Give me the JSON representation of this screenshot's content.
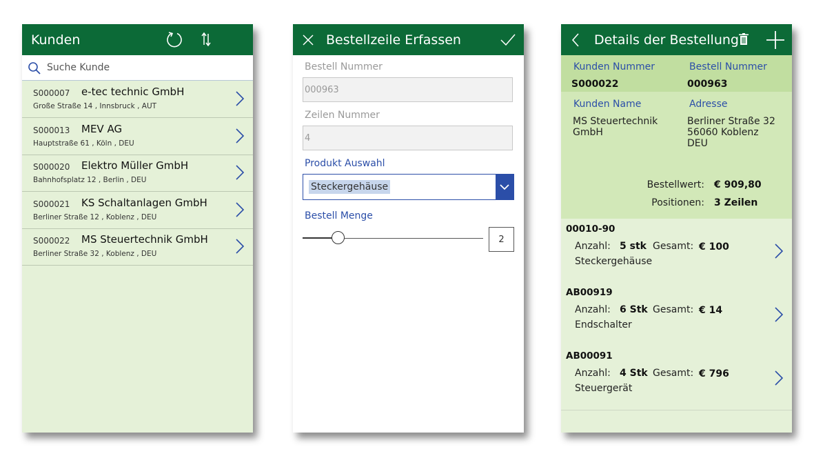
{
  "customers_screen": {
    "title": "Kunden",
    "refresh_icon": "refresh-icon",
    "sort_icon": "sort-icon",
    "search_placeholder": "Suche Kunde",
    "customers": [
      {
        "id": "S000007",
        "name": "e-tec technic GmbH",
        "address": "Große Straße 14 , Innsbruck , AUT"
      },
      {
        "id": "S000013",
        "name": "MEV AG",
        "address": "Hauptstraße 61 , Köln , DEU"
      },
      {
        "id": "S000020",
        "name": "Elektro Müller GmbH",
        "address": "Bahnhofsplatz 12 , Berlin , DEU"
      },
      {
        "id": "S000021",
        "name": "KS Schaltanlagen GmbH",
        "address": "Berliner Straße 12 , Koblenz , DEU"
      },
      {
        "id": "S000022",
        "name": "MS Steuertechnik GmbH",
        "address": "Berliner Straße 32 , Koblenz , DEU"
      }
    ]
  },
  "order_line_screen": {
    "title": "Bestellzeile Erfassen",
    "order_number_label": "Bestell Nummer",
    "order_number_value": "000963",
    "line_number_label": "Zeilen Nummer",
    "line_number_value": "4",
    "product_label": "Produkt Auswahl",
    "product_selected": "Steckergehäuse",
    "quantity_label": "Bestell Menge",
    "quantity_value": "2",
    "accent_color": "#2b4ea8"
  },
  "order_details_screen": {
    "title": "Details der Bestellung",
    "customer_number_label": "Kunden Nummer",
    "customer_number_value": "S000022",
    "order_number_label": "Bestell Nummer",
    "order_number_value": "000963",
    "customer_name_label": "Kunden Name",
    "customer_name_value": "MS Steuertechnik GmbH",
    "address_label": "Adresse",
    "address_lines": [
      "Berliner Straße 32",
      "56060 Koblenz",
      "DEU"
    ],
    "order_value_label": "Bestellwert:",
    "order_value": "€ 909,80",
    "positions_label": "Positionen:",
    "positions_value": "3 Zeilen",
    "lines": [
      {
        "id": "00010-90",
        "qty_label": "Anzahl:",
        "qty": "5 stk",
        "total_label": "Gesamt:",
        "total": "€ 100",
        "product": "Steckergehäuse"
      },
      {
        "id": "AB00919",
        "qty_label": "Anzahl:",
        "qty": "6 Stk",
        "total_label": "Gesamt:",
        "total": "€ 14",
        "product": "Endschalter"
      },
      {
        "id": "AB00091",
        "qty_label": "Anzahl:",
        "qty": "4 Stk",
        "total_label": "Gesamt:",
        "total": "€ 796",
        "product": "Steuergerät"
      }
    ]
  },
  "colors": {
    "header_green": "#0c6a37",
    "list_bg": "#e5f1d8",
    "info_bg": "#c1dea0"
  }
}
